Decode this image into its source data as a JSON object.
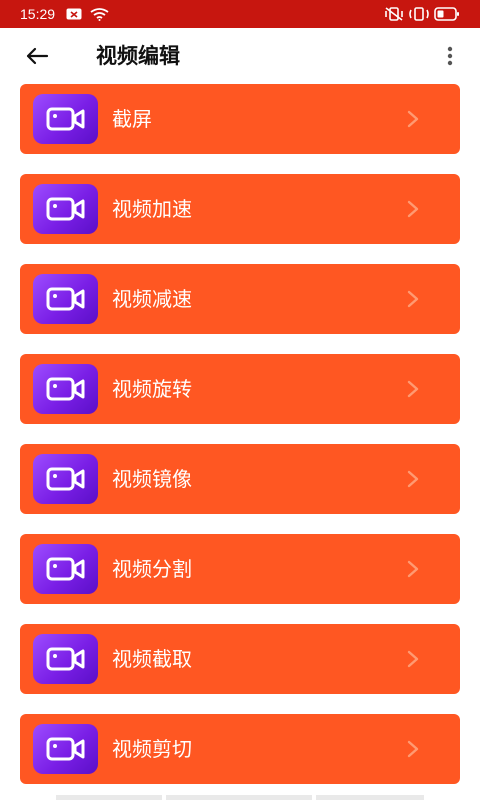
{
  "status_bar": {
    "time": "15:29",
    "icons": [
      "notification-icon",
      "wifi-icon",
      "vibrate-off-icon",
      "vibrate-icon",
      "battery-icon"
    ]
  },
  "app_bar": {
    "title": "视频编辑",
    "back_icon": "arrow-left-icon",
    "menu_icon": "more-vertical-icon"
  },
  "colors": {
    "status_bar": "#c7160f",
    "card": "#ff5722",
    "icon_gradient_start": "#9d4cff",
    "icon_gradient_end": "#5b0fc8",
    "chevron": "#ff9a72"
  },
  "items": [
    {
      "label": "截屏",
      "icon": "video-camera-icon"
    },
    {
      "label": "视频加速",
      "icon": "video-camera-icon"
    },
    {
      "label": "视频减速",
      "icon": "video-camera-icon"
    },
    {
      "label": "视频旋转",
      "icon": "video-camera-icon"
    },
    {
      "label": "视频镜像",
      "icon": "video-camera-icon"
    },
    {
      "label": "视频分割",
      "icon": "video-camera-icon"
    },
    {
      "label": "视频截取",
      "icon": "video-camera-icon"
    },
    {
      "label": "视频剪切",
      "icon": "video-camera-icon"
    }
  ]
}
